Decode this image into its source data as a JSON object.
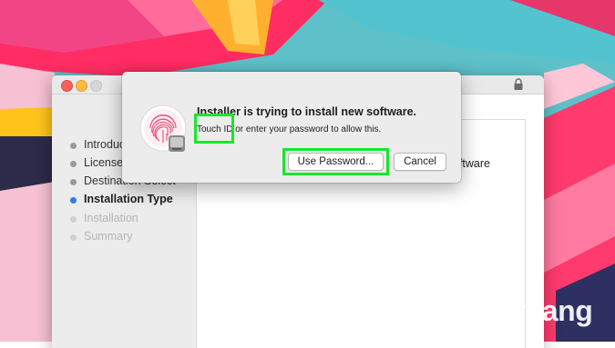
{
  "installer": {
    "steps": [
      {
        "label": "Introduction",
        "state": "done"
      },
      {
        "label": "License",
        "state": "done"
      },
      {
        "label": "Destination Select",
        "state": "done"
      },
      {
        "label": "Installation Type",
        "state": "active"
      },
      {
        "label": "Installation",
        "state": "pending"
      },
      {
        "label": "Summary",
        "state": "pending"
      }
    ],
    "content_text_visible": "oftware"
  },
  "auth_dialog": {
    "title": "Installer is trying to install new software.",
    "message_highlight": "Touch ID",
    "message_rest": " or enter your password to allow this.",
    "use_password_label": "Use Password...",
    "cancel_label": "Cancel"
  },
  "colors": {
    "highlight_box": "#19e62b",
    "active_step": "#2b7de9",
    "close": "#fc605c",
    "minimize": "#fdbc40"
  },
  "icons": [
    "fingerprint-icon",
    "lock-icon",
    "watermark-logo"
  ],
  "watermark": {
    "text": "uantrimang"
  }
}
